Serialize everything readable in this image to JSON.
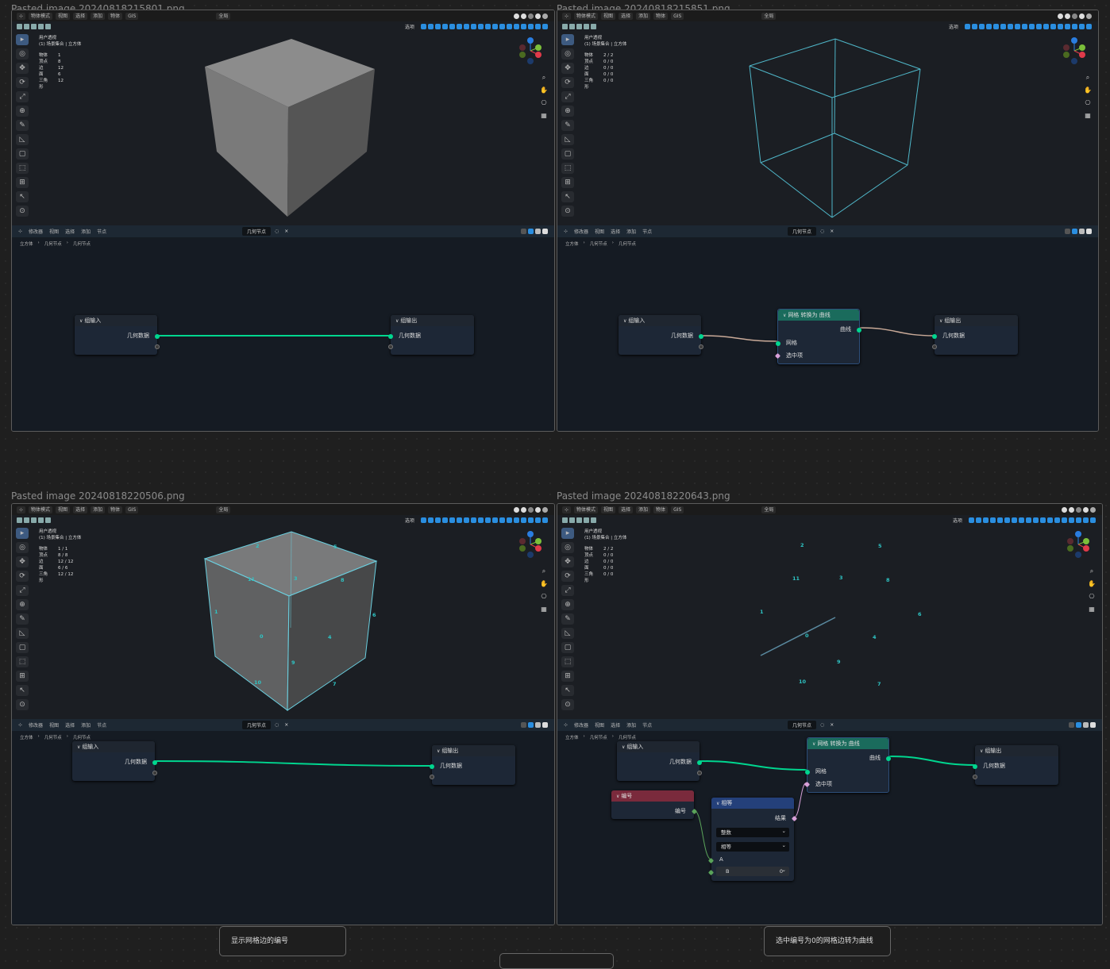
{
  "panels": [
    {
      "title": "Pasted image 20240818215801.png",
      "stats": [
        {
          "label": "物体",
          "value": "1"
        },
        {
          "label": "顶点",
          "value": "8"
        },
        {
          "label": "边",
          "value": "12"
        },
        {
          "label": "面",
          "value": "6"
        },
        {
          "label": "三角形",
          "value": "12"
        }
      ]
    },
    {
      "title": "Pasted image 20240818215851.png",
      "stats": [
        {
          "label": "物体",
          "value": "2 / 2"
        },
        {
          "label": "顶点",
          "value": "0 / 0"
        },
        {
          "label": "边",
          "value": "0 / 0"
        },
        {
          "label": "面",
          "value": "0 / 0"
        },
        {
          "label": "三角形",
          "value": "0 / 0"
        }
      ]
    },
    {
      "title": "Pasted image 20240818220506.png",
      "stats": [
        {
          "label": "物体",
          "value": "1 / 1"
        },
        {
          "label": "顶点",
          "value": "8 / 8"
        },
        {
          "label": "边",
          "value": "12 / 12"
        },
        {
          "label": "面",
          "value": "6 / 6"
        },
        {
          "label": "三角形",
          "value": "12 / 12"
        }
      ]
    },
    {
      "title": "Pasted image 20240818220643.png",
      "stats": [
        {
          "label": "物体",
          "value": "2 / 2"
        },
        {
          "label": "顶点",
          "value": "0 / 0"
        },
        {
          "label": "边",
          "value": "0 / 0"
        },
        {
          "label": "面",
          "value": "0 / 0"
        },
        {
          "label": "三角形",
          "value": "0 / 0"
        }
      ]
    }
  ],
  "viewport": {
    "mode": "物体模式",
    "menu": [
      "视图",
      "选择",
      "添加",
      "物体",
      "GIS"
    ],
    "transform": "全局",
    "options": "选项",
    "view_name": "用户透视",
    "collection": "(1) 场景集合 | 立方体"
  },
  "node_editor": {
    "editor_type": "修改器",
    "menu": [
      "视图",
      "选择",
      "添加",
      "节点"
    ],
    "tree_name": "几何节点",
    "breadcrumb": [
      "立方体",
      "几何节点",
      "几何节点"
    ]
  },
  "nodes": {
    "group_input": {
      "title": "组输入",
      "socket": "几何数据"
    },
    "group_output": {
      "title": "组输出",
      "socket": "几何数据"
    },
    "mesh_to_curve": {
      "title": "网格 转换为 曲线",
      "output": "曲线",
      "inputs": [
        "网格",
        "选中项"
      ]
    },
    "index": {
      "title": "编号",
      "output": "编号"
    },
    "compare": {
      "title": "相等",
      "output": "结果",
      "data_type": "整数",
      "operation": "相等",
      "input_a": "A",
      "input_b": "B",
      "b_value": "0"
    }
  },
  "edge_indices": [
    "0",
    "1",
    "2",
    "3",
    "4",
    "5",
    "6",
    "7",
    "8",
    "9",
    "10",
    "11"
  ],
  "captions": [
    "显示网格边的编号",
    "选中编号为0的网格边转为曲线"
  ],
  "colors": {
    "group_header": "#1f2630",
    "convert_header": "#1a6b5c",
    "index_header": "#7a2a3c",
    "compare_header": "#24407a",
    "geometry_link": "#00d68f",
    "link_muted": "#c9aa98"
  }
}
